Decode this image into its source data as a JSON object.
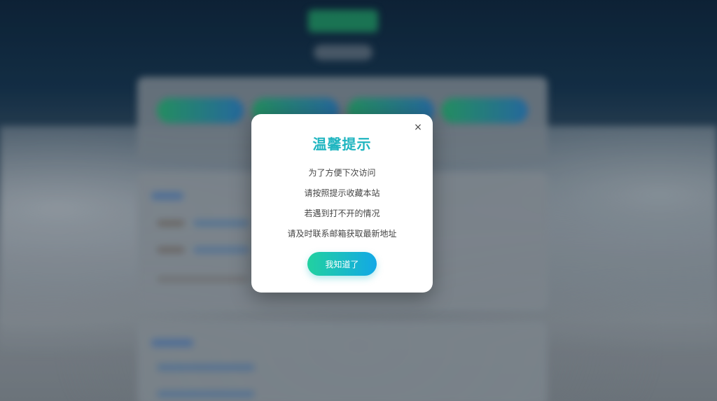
{
  "dialog": {
    "title": "温馨提示",
    "close_glyph": "×",
    "lines": [
      "为了方便下次访问",
      "请按照提示收藏本站",
      "若遇到打不开的情况",
      "请及时联系邮箱获取最新地址"
    ],
    "confirm_label": "我知道了"
  },
  "colors": {
    "title": "#1fb5c0",
    "button_gradient_start": "#22d1a0",
    "button_gradient_end": "#12a8e6"
  }
}
